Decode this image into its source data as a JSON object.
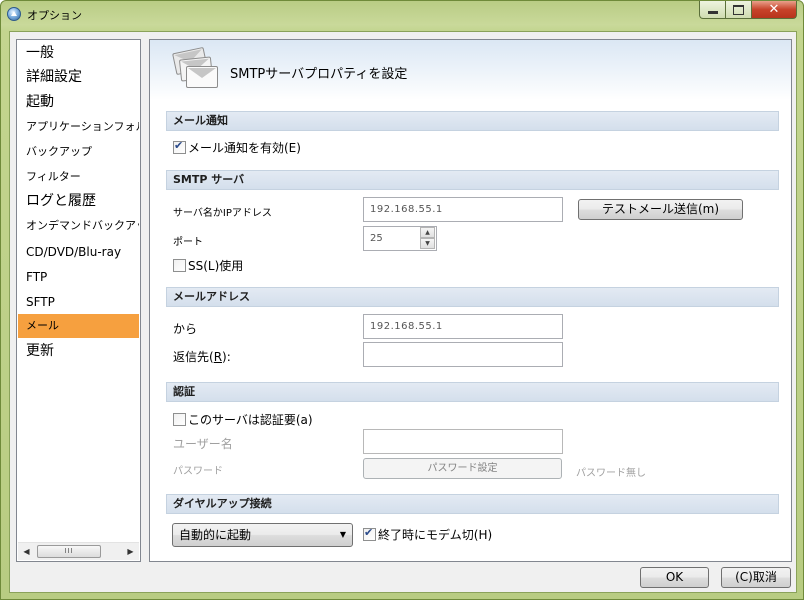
{
  "window": {
    "title": "オプション",
    "close_glyph": "✕"
  },
  "sidebar": {
    "items": [
      {
        "label": "一般",
        "size": "big"
      },
      {
        "label": "詳細設定",
        "size": "big"
      },
      {
        "label": "起動",
        "size": "big"
      },
      {
        "label": "アプリケーションフォルダ",
        "size": "small"
      },
      {
        "label": "バックアップ",
        "size": "small"
      },
      {
        "label": "フィルター",
        "size": "small"
      },
      {
        "label": "ログと履歴",
        "size": "big"
      },
      {
        "label": "オンデマンドバックアップ",
        "size": "small"
      },
      {
        "label": "CD/DVD/Blu-ray",
        "size": "med"
      },
      {
        "label": "FTP",
        "size": "med"
      },
      {
        "label": "SFTP",
        "size": "med"
      },
      {
        "label": "メール",
        "size": "small",
        "active": true
      },
      {
        "label": "更新",
        "size": "big"
      }
    ],
    "scroll_left": "◀",
    "scroll_right": "▶",
    "scroll_thumb": "III"
  },
  "panel": {
    "title": "SMTPサーバプロパティを設定",
    "notify": {
      "section": "メール通知",
      "enable_label": "メール通知を有効(E)",
      "enable_checked": true
    },
    "smtp": {
      "section": "SMTP サーバ",
      "server_label": "サーバ名かIPアドレス",
      "server_value": "192.168.55.1",
      "test_button": "テストメール送信(m)",
      "port_label": "ポート",
      "port_value": "25",
      "ssl_label": "SS(L)使用",
      "ssl_checked": false
    },
    "address": {
      "section": "メールアドレス",
      "from_label": "から",
      "from_value": "192.168.55.1",
      "reply_label_pre": "返信先(",
      "reply_label_key": "R",
      "reply_label_post": "):",
      "reply_value": ""
    },
    "auth": {
      "section": "認証",
      "required_label": "このサーバは認証要(a)",
      "required_checked": false,
      "user_label": "ユーザー名",
      "user_value": "",
      "password_label": "パスワード",
      "password_button": "パスワード設定",
      "password_status": "パスワード無し"
    },
    "dialup": {
      "section": "ダイヤルアップ接続",
      "mode_selected": "自動的に起動",
      "hangup_label": "終了時にモデム切(H)",
      "hangup_checked": true
    }
  },
  "footer": {
    "ok": "OK",
    "cancel": "(C)取消"
  },
  "colors": {
    "active_item": "#f6a03f",
    "section_band": "#d9e3ef",
    "window_frame": "#c3d58f"
  }
}
